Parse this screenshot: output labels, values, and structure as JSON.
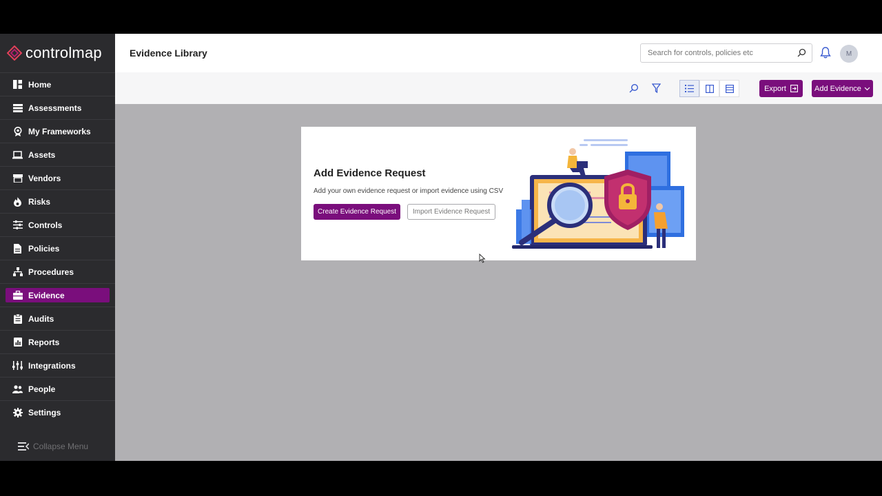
{
  "brand": {
    "name": "controlmap",
    "accent": "#7a0e7c"
  },
  "sidebar": {
    "items": [
      {
        "label": "Home",
        "icon": "home-icon"
      },
      {
        "label": "Assessments",
        "icon": "list-icon"
      },
      {
        "label": "My Frameworks",
        "icon": "badge-icon"
      },
      {
        "label": "Assets",
        "icon": "laptop-icon"
      },
      {
        "label": "Vendors",
        "icon": "store-icon"
      },
      {
        "label": "Risks",
        "icon": "fire-icon"
      },
      {
        "label": "Controls",
        "icon": "sliders-icon"
      },
      {
        "label": "Policies",
        "icon": "document-icon"
      },
      {
        "label": "Procedures",
        "icon": "sitemap-icon"
      },
      {
        "label": "Evidence",
        "icon": "briefcase-icon",
        "active": true
      },
      {
        "label": "Audits",
        "icon": "clipboard-icon"
      },
      {
        "label": "Reports",
        "icon": "chart-icon"
      },
      {
        "label": "Integrations",
        "icon": "integration-icon"
      },
      {
        "label": "People",
        "icon": "people-icon"
      },
      {
        "label": "Settings",
        "icon": "gear-icon"
      }
    ],
    "collapse_label": "Collapse Menu"
  },
  "header": {
    "title": "Evidence Library",
    "search_placeholder": "Search for controls, policies etc",
    "avatar_initial": "M"
  },
  "toolbar": {
    "export_label": "Export",
    "add_label": "Add Evidence"
  },
  "card": {
    "title": "Add Evidence Request",
    "description": "Add your own evidence request or import evidence using CSV",
    "create_label": "Create Evidence Request",
    "import_label": "Import Evidence Request"
  }
}
